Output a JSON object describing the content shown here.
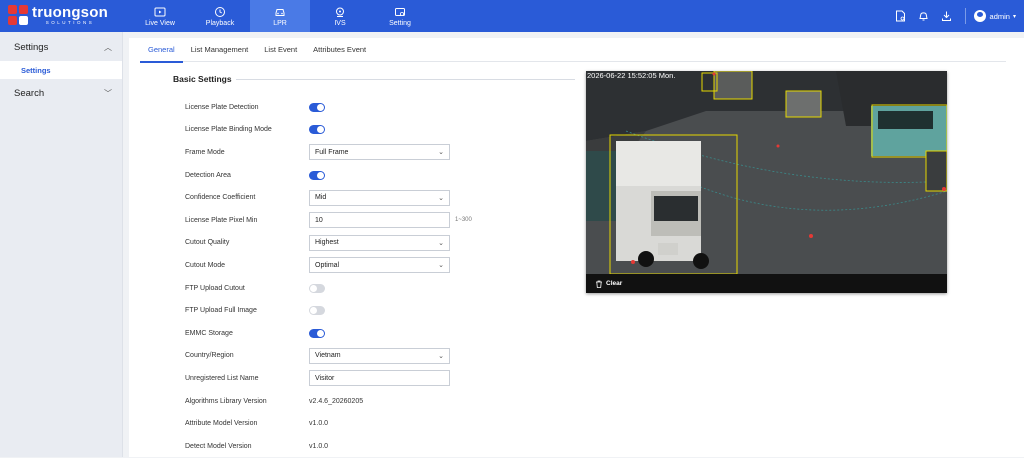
{
  "brand": {
    "name": "truongson",
    "sub": "SOLUTIONS"
  },
  "nav": [
    {
      "label": "Live View",
      "icon": "live-view-icon"
    },
    {
      "label": "Playback",
      "icon": "playback-icon"
    },
    {
      "label": "LPR",
      "icon": "car-icon",
      "active": true
    },
    {
      "label": "IVS",
      "icon": "ivs-icon"
    },
    {
      "label": "Setting",
      "icon": "setting-icon"
    }
  ],
  "user": {
    "name": "admin"
  },
  "sidebar": {
    "settings_label": "Settings",
    "settings_sub": "Settings",
    "search_label": "Search"
  },
  "tabs": [
    "General",
    "List Management",
    "List Event",
    "Attributes Event"
  ],
  "section_title": "Basic Settings",
  "form": {
    "lpd": {
      "label": "License Plate Detection",
      "on": true
    },
    "lpbm": {
      "label": "License Plate Binding Mode",
      "on": true
    },
    "frame_mode": {
      "label": "Frame Mode",
      "value": "Full Frame"
    },
    "detection_area": {
      "label": "Detection Area",
      "on": true
    },
    "confidence": {
      "label": "Confidence Coefficient",
      "value": "Mid"
    },
    "pixel_min": {
      "label": "License Plate Pixel Min",
      "value": "10",
      "hint": "1~300"
    },
    "cutout_quality": {
      "label": "Cutout Quality",
      "value": "Highest"
    },
    "cutout_mode": {
      "label": "Cutout Mode",
      "value": "Optimal"
    },
    "ftp_cutout": {
      "label": "FTP Upload Cutout",
      "on": false
    },
    "ftp_full": {
      "label": "FTP Upload Full Image",
      "on": false
    },
    "emmc": {
      "label": "EMMC Storage",
      "on": true
    },
    "country": {
      "label": "Country/Region",
      "value": "Vietnam"
    },
    "unregistered": {
      "label": "Unregistered List Name",
      "value": "Visitor"
    },
    "algo": {
      "label": "Algorithms Library Version",
      "value": "v2.4.6_20260205"
    },
    "attr_model": {
      "label": "Attribute Model Version",
      "value": "v1.0.0"
    },
    "detect_model": {
      "label": "Detect Model Version",
      "value": "v1.0.0"
    }
  },
  "preview": {
    "timestamp": "2026-06-22 15:52:05 Mon.",
    "clear_label": "Clear"
  },
  "colors": {
    "primary": "#2a5bd7",
    "detect_box": "#e5d800",
    "plate_dot": "#e53935"
  }
}
